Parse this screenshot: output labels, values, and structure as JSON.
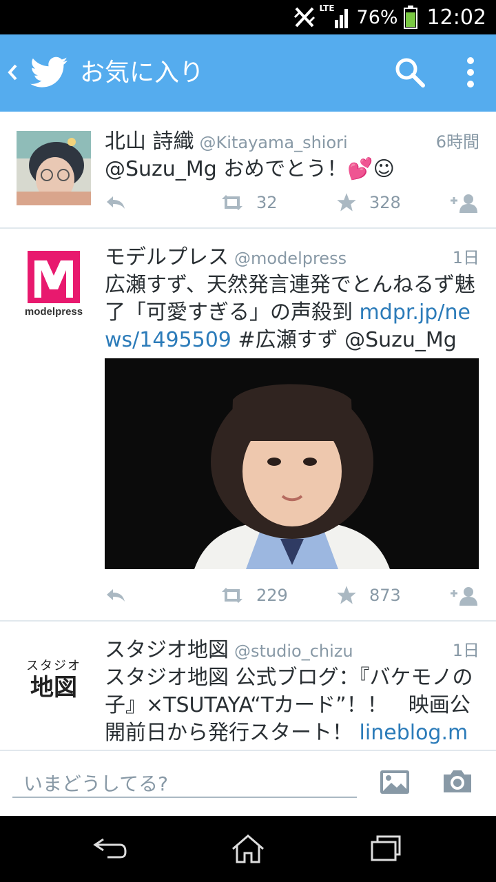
{
  "status_bar": {
    "network": "LTE",
    "battery": "76%",
    "time": "12:02"
  },
  "app_bar": {
    "title": "お気に入り"
  },
  "tweets": [
    {
      "name": "北山 詩織",
      "handle": "@Kitayama_shiori",
      "time": "6時間",
      "text_parts": [
        "@Suzu_Mg おめでとう！💕☺"
      ],
      "retweets": "32",
      "favorites": "328"
    },
    {
      "name": "モデルプレス",
      "handle": "@modelpress",
      "time": "1日",
      "text_parts": [
        "広瀬すず、天然発言連発でとんねるず魅了「可愛すぎる」の声殺到 ",
        "mdpr.jp/news/1495509",
        " #広瀬すず @Suzu_Mg"
      ],
      "avatar_label": "modelpress",
      "retweets": "229",
      "favorites": "873"
    },
    {
      "name": "スタジオ地図",
      "handle": "@studio_chizu",
      "time": "1日",
      "text_parts": [
        "スタジオ地図 公式ブログ：『バケモノの子』×TSUTAYA“Tカード”！！　映画公開前日から発行スタート！ ",
        "lineblog.me/"
      ],
      "avatar_small": "スタジオ",
      "avatar_big": "地図"
    }
  ],
  "composer": {
    "placeholder": "いまどうしてる?"
  },
  "icons": {
    "status": [
      "no-sim-icon",
      "signal-icon",
      "battery-icon"
    ],
    "app_bar": [
      "back-chevron-icon",
      "twitter-bird-icon",
      "search-icon",
      "overflow-menu-icon"
    ],
    "tweet_actions": [
      "reply-icon",
      "retweet-icon",
      "star-icon",
      "follow-icon"
    ],
    "composer": [
      "image-icon",
      "camera-icon"
    ],
    "nav": [
      "back-icon",
      "home-icon",
      "recents-icon"
    ]
  },
  "colors": {
    "accent": "#55acee",
    "link": "#2b7bb9",
    "muted": "#8899a6",
    "brand_modelpress": "#e8196e"
  }
}
